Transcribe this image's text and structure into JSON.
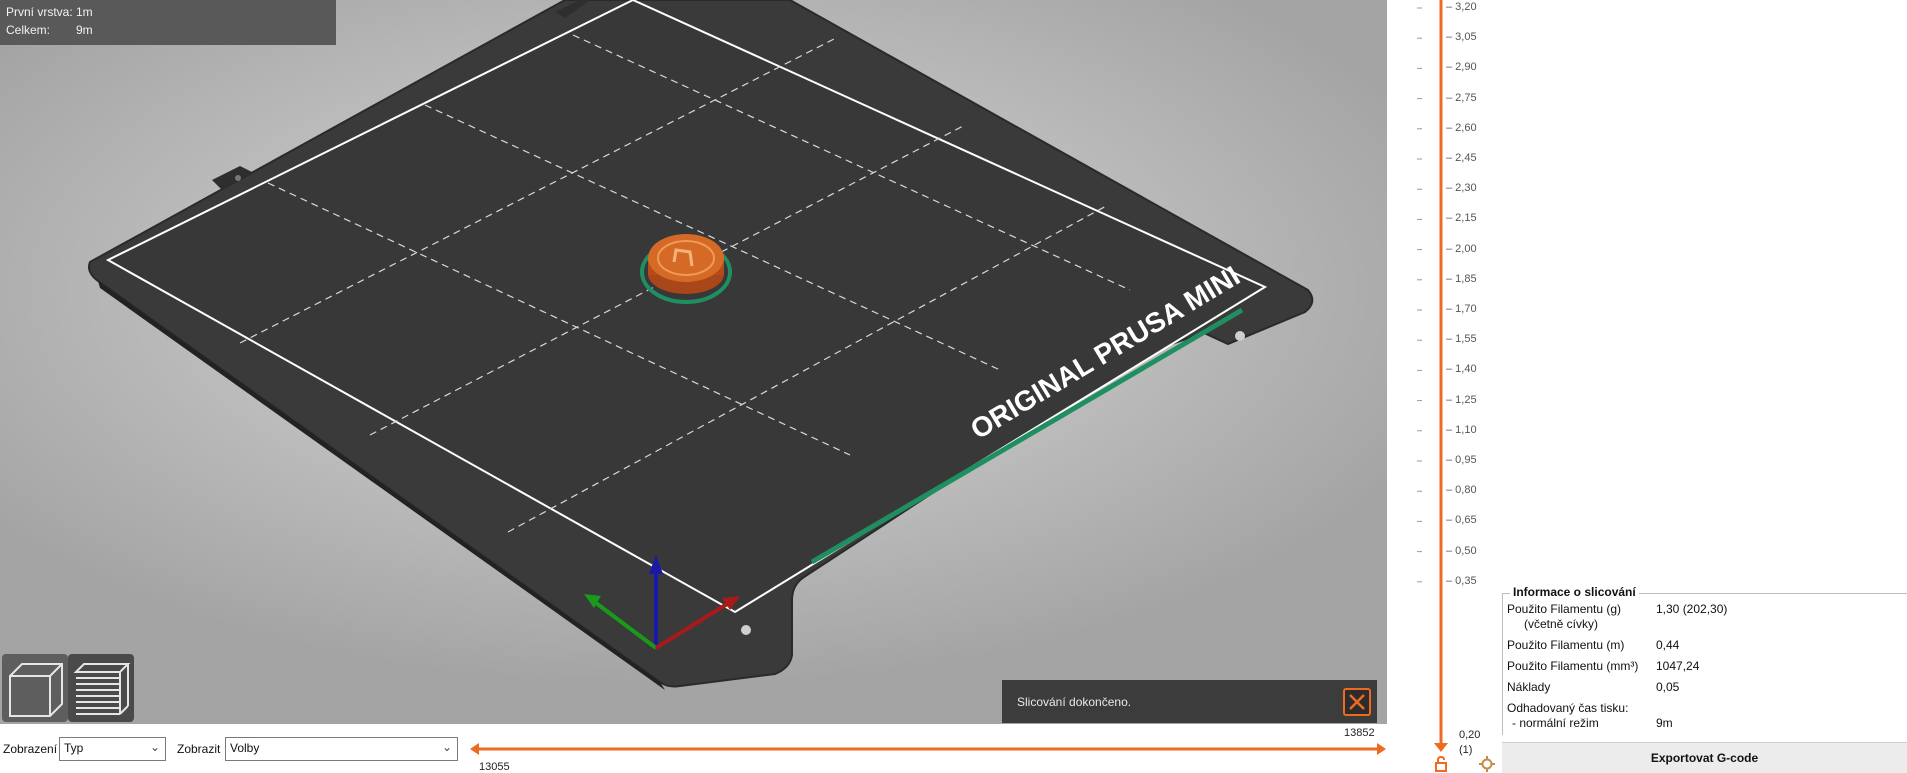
{
  "stats": {
    "first_layer_label": "První vrstva:",
    "first_layer_value": "1m",
    "total_label": "Celkem:",
    "total_value": "9m"
  },
  "bed": {
    "brand_text": "ORIGINAL PRUSA MINI"
  },
  "notification": {
    "text": "Slicování dokončeno."
  },
  "bottom_bar": {
    "view_label": "Zobrazení",
    "view_value": "Typ",
    "show_label": "Zobrazit",
    "show_value": "Volby",
    "slider_upper_value": "13852",
    "slider_lower_value": "13055"
  },
  "layer_slider": {
    "ticks": [
      "3,20",
      "3,05",
      "2,90",
      "2,75",
      "2,60",
      "2,45",
      "2,30",
      "2,15",
      "2,00",
      "1,85",
      "1,70",
      "1,55",
      "1,40",
      "1,25",
      "1,10",
      "0,95",
      "0,80",
      "0,65",
      "0,50",
      "0,35"
    ],
    "bottom_value": "0,20",
    "bottom_index": "(1)"
  },
  "slice_info": {
    "title": "Informace o slicování",
    "filament_g_label": "Použito Filamentu (g)",
    "filament_g_sub": "(včetně cívky)",
    "filament_g_value": "1,30 (202,30)",
    "filament_m_label": "Použito Filamentu (m)",
    "filament_m_value": "0,44",
    "filament_mm3_label": "Použito Filamentu (mm³)",
    "filament_mm3_value": "1047,24",
    "cost_label": "Náklady",
    "cost_value": "0,05",
    "print_time_label": "Odhadovaný čas tisku:",
    "normal_mode_label": "- normální režim",
    "normal_mode_value": "9m"
  },
  "export_button": {
    "label": "Exportovat G-code"
  },
  "colors": {
    "accent": "#ed6b21",
    "bed": "#3d3d3d",
    "status_green": "#1f8f61"
  }
}
